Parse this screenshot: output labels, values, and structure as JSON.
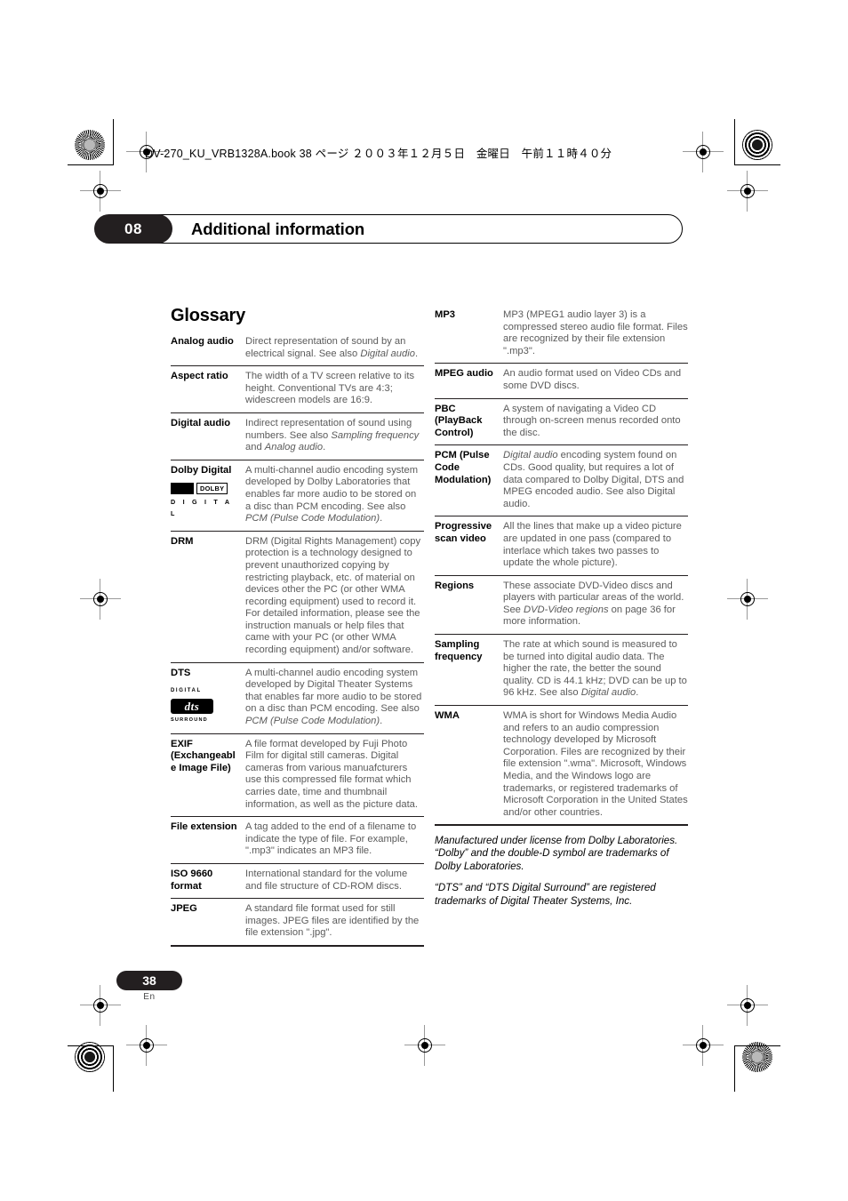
{
  "print_header": {
    "book_line": "DV-270_KU_VRB1328A.book  38 ページ  ２００３年１２月５日　金曜日　午前１１時４０分"
  },
  "chapter": {
    "number": "08",
    "title": "Additional information"
  },
  "section": {
    "heading": "Glossary"
  },
  "glossary": {
    "left_column": [
      {
        "term": "Analog audio",
        "definition": "Direct representation of sound by an electrical signal. See also Digital audio.",
        "italics": [
          "Digital audio"
        ],
        "logo": ""
      },
      {
        "term": "Aspect ratio",
        "definition": "The width of a TV screen relative to its height. Conventional TVs are 4:3; widescreen models are 16:9.",
        "italics": [],
        "logo": ""
      },
      {
        "term": "Digital audio",
        "definition": "Indirect representation of sound using numbers. See also Sampling frequency and Analog audio.",
        "italics": [
          "Sampling frequency",
          "Analog audio"
        ],
        "logo": ""
      },
      {
        "term": "Dolby Digital",
        "definition": "A multi-channel audio encoding system developed by Dolby Laboratories that enables far more audio to be stored on a disc than PCM encoding. See also PCM (Pulse Code Modulation).",
        "italics": [
          "PCM (Pulse Code Modulation)"
        ],
        "logo": "dolby-digital-logo"
      },
      {
        "term": "DRM",
        "definition": "DRM (Digital Rights Management) copy protection is a technology designed to prevent unauthorized copying by restricting playback, etc. of material on devices other the PC (or other WMA recording equipment) used to record it. For detailed information, please see the instruction manuals or help files that came with your PC (or other WMA recording equipment) and/or software.",
        "italics": [],
        "logo": ""
      },
      {
        "term": "DTS",
        "definition": "A multi-channel audio encoding system developed by Digital Theater Systems that enables far more audio to be stored on a disc than PCM encoding. See also PCM (Pulse Code Modulation).",
        "italics": [
          "PCM (Pulse Code Modulation)"
        ],
        "logo": "dts-digital-surround-logo"
      },
      {
        "term": "EXIF (Exchangeabl e Image File)",
        "definition": "A file format developed by Fuji Photo Film for digital still cameras. Digital cameras from various manuafcturers use this compressed file format which carries date, time and thumbnail information, as well as the picture data.",
        "italics": [],
        "logo": ""
      },
      {
        "term": "File extension",
        "definition": "A tag added to the end of a filename to indicate the type of file. For example, \".mp3\" indicates an MP3 file.",
        "italics": [],
        "logo": ""
      },
      {
        "term": "ISO 9660 format",
        "definition": "International standard for the volume and file structure of CD-ROM discs.",
        "italics": [],
        "logo": ""
      },
      {
        "term": "JPEG",
        "definition": "A standard file format used for still images. JPEG files are identified by the file extension \".jpg\".",
        "italics": [],
        "logo": ""
      }
    ],
    "right_column": [
      {
        "term": "MP3",
        "definition": "MP3 (MPEG1 audio layer 3) is a compressed stereo audio file format. Files are recognized by their file extension \".mp3\".",
        "italics": [],
        "logo": ""
      },
      {
        "term": "MPEG audio",
        "definition": "An audio format used on Video CDs and some DVD discs.",
        "italics": [],
        "logo": ""
      },
      {
        "term": "PBC (PlayBack Control)",
        "definition": "A system of navigating a Video CD through on-screen menus recorded onto the disc.",
        "italics": [],
        "logo": ""
      },
      {
        "term": "PCM (Pulse Code Modulation)",
        "definition": "Digital audio encoding system found on CDs. Good quality, but requires a lot of data compared to Dolby Digital, DTS and MPEG encoded audio. See also Digital audio.",
        "italics": [
          "Digital audio"
        ],
        "logo": ""
      },
      {
        "term": "Progressive scan video",
        "definition": "All the lines that make up a video picture are updated in one pass (compared to interlace which takes two passes to update the whole picture).",
        "italics": [],
        "logo": ""
      },
      {
        "term": "Regions",
        "definition": "These associate DVD-Video discs and players with particular areas of the world. See DVD-Video regions on page 36 for more information.",
        "italics": [
          "DVD-Video regions"
        ],
        "logo": ""
      },
      {
        "term": "Sampling frequency",
        "definition": "The rate at which sound is measured to be turned into digital audio data. The higher the rate, the better the sound quality. CD is 44.1 kHz; DVD can be up to 96 kHz. See also Digital audio.",
        "italics": [
          "Digital audio"
        ],
        "logo": ""
      },
      {
        "term": "WMA",
        "definition": "WMA is short for Windows Media Audio and refers to an audio compression technology developed by Microsoft Corporation. Files are recognized by their file extension \".wma\". Microsoft, Windows Media, and the Windows logo are trademarks, or registered trademarks of Microsoft Corporation in the United States and/or other countries.",
        "italics": [],
        "logo": ""
      }
    ]
  },
  "trademark_notices": [
    "Manufactured under license from Dolby Laboratories. “Dolby” and the double-D symbol are trademarks of Dolby Laboratories.",
    "“DTS” and “DTS Digital Surround” are registered trademarks of Digital Theater Systems, Inc."
  ],
  "logos": {
    "dolby": {
      "word": "DOLBY",
      "subtitle": "D I G I T A L"
    },
    "dts": {
      "top": "DIGITAL",
      "word": "dts",
      "bottom": "SURROUND"
    }
  },
  "footer": {
    "page_number": "38",
    "language_code": "En"
  }
}
